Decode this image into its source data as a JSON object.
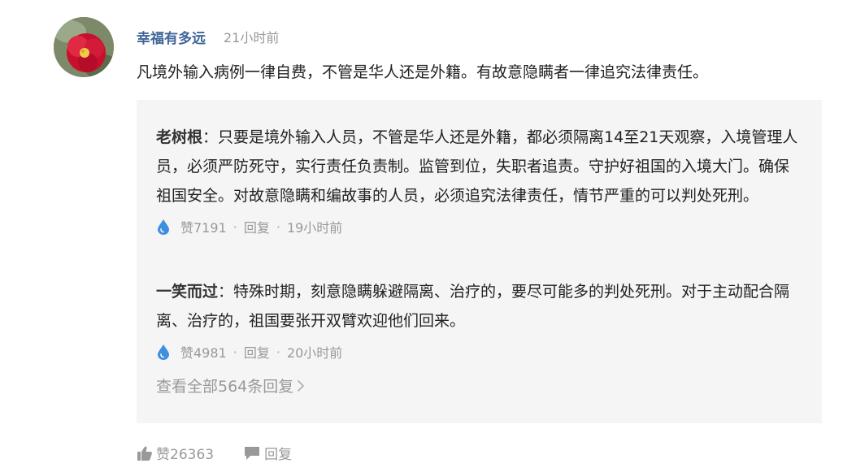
{
  "comment": {
    "username": "幸福有多远",
    "time": "21小时前",
    "text": "凡境外输入病例一律自费，不管是华人还是外籍。有故意隐瞒者一律追究法律责任。",
    "likes_label": "赞26363",
    "reply_label": "回复"
  },
  "replies": [
    {
      "user": "老树根",
      "colon": "：",
      "text": "只要是境外输入人员，不管是华人还是外籍，都必须隔离14至21天观察，入境管理人员，必须严防死守，实行责任负责制。监管到位，失职者追责。守护好祖国的入境大门。确保祖国安全。对故意隐瞒和编故事的人员，必须追究法律责任，情节严重的可以判处死刑。",
      "likes_label": "赞7191",
      "sep": "·",
      "reply_label": "回复",
      "time": "19小时前"
    },
    {
      "user": "一笑而过",
      "colon": "：",
      "text": "特殊时期，刻意隐瞒躲避隔离、治疗的，要尽可能多的判处死刑。对于主动配合隔离、治疗的，祖国要张开双臂欢迎他们回来。",
      "likes_label": "赞4981",
      "sep": "·",
      "reply_label": "回复",
      "time": "20小时前"
    }
  ],
  "view_all_label": "查看全部564条回复",
  "colors": {
    "username": "#406599",
    "muted": "#999999",
    "reply_bg": "#f5f5f5",
    "like_icon": "#3f8fe0"
  },
  "icons": {
    "like": "water-drop-icon",
    "thumb": "thumbs-up-icon",
    "comment": "speech-bubble-icon",
    "more": "chevron-right-icon"
  }
}
